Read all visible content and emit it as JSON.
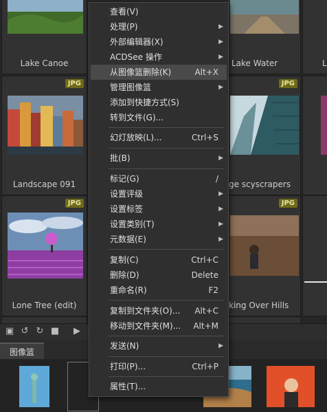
{
  "grid": {
    "tiles": [
      {
        "caption": "Lake Canoe",
        "badge": ""
      },
      {
        "caption": "Lake Water",
        "badge": ""
      },
      {
        "caption": "L",
        "badge": ""
      },
      {
        "caption": "Landscape 091",
        "badge": "JPG"
      },
      {
        "caption": "ge scyscrapers",
        "badge": "JPG"
      },
      {
        "caption": "Lone Tree (edit)",
        "badge": "JPG"
      },
      {
        "caption": "king Over Hills",
        "badge": "JPG"
      }
    ]
  },
  "basket": {
    "tab_label": "图像篮"
  },
  "context_menu": {
    "items": [
      {
        "label": "查看(V)",
        "shortcut": "",
        "submenu": false
      },
      {
        "label": "处理(P)",
        "shortcut": "",
        "submenu": true
      },
      {
        "label": "外部编辑器(X)",
        "shortcut": "",
        "submenu": true
      },
      {
        "label": "ACDSee 操作",
        "shortcut": "",
        "submenu": true
      },
      {
        "label": "从图像篮删除(K)",
        "shortcut": "Alt+X",
        "submenu": false,
        "highlighted": true
      },
      {
        "label": "管理图像篮",
        "shortcut": "",
        "submenu": true
      },
      {
        "label": "添加到快捷方式(S)",
        "shortcut": "",
        "submenu": false
      },
      {
        "label": "转到文件(G)...",
        "shortcut": "",
        "submenu": false
      },
      {
        "label": "幻灯放映(L)...",
        "shortcut": "Ctrl+S",
        "submenu": false
      },
      {
        "label": "批(B)",
        "shortcut": "",
        "submenu": true
      },
      {
        "label": "标记(G)",
        "shortcut": "/",
        "submenu": false
      },
      {
        "label": "设置评级",
        "shortcut": "",
        "submenu": true
      },
      {
        "label": "设置标签",
        "shortcut": "",
        "submenu": true
      },
      {
        "label": "设置类别(T)",
        "shortcut": "",
        "submenu": true
      },
      {
        "label": "元数据(E)",
        "shortcut": "",
        "submenu": true
      },
      {
        "label": "复制(C)",
        "shortcut": "Ctrl+C",
        "submenu": false
      },
      {
        "label": "删除(D)",
        "shortcut": "Delete",
        "submenu": false
      },
      {
        "label": "重命名(R)",
        "shortcut": "F2",
        "submenu": false
      },
      {
        "label": "复制到文件夹(O)...",
        "shortcut": "Alt+C",
        "submenu": false
      },
      {
        "label": "移动到文件夹(M)...",
        "shortcut": "Alt+M",
        "submenu": false
      },
      {
        "label": "发送(N)",
        "shortcut": "",
        "submenu": true
      },
      {
        "label": "打印(P)...",
        "shortcut": "Ctrl+P",
        "submenu": false
      },
      {
        "label": "属性(T)...",
        "shortcut": "",
        "submenu": false
      }
    ]
  }
}
